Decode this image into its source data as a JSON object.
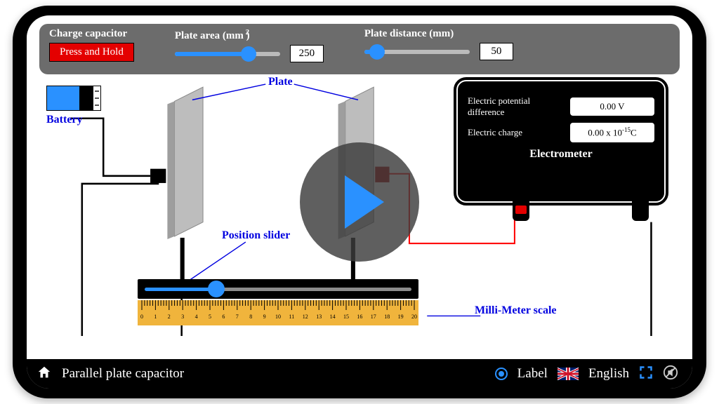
{
  "controls": {
    "charge_label": "Charge capacitor",
    "press_hold": "Press and Hold",
    "area_label": "Plate area (mm   )",
    "area_exponent": "2",
    "area_value": "250",
    "area_slider_pct": 70,
    "distance_label": "Plate distance (mm)",
    "distance_value": "50",
    "distance_slider_pct": 12
  },
  "labels": {
    "plate": "Plate",
    "battery": "Battery",
    "position_slider": "Position slider",
    "mm_scale": "Milli-Meter scale"
  },
  "meter": {
    "potential_label": "Electric potential difference",
    "potential_value": "0.00 V",
    "charge_label": "Electric charge",
    "charge_value_main": "0.00 x 10",
    "charge_exp": "-15",
    "charge_unit": "C",
    "title": "Electrometer"
  },
  "position_slider_pct": 28,
  "ruler": {
    "ticks": [
      "0",
      "1",
      "2",
      "3",
      "4",
      "5",
      "6",
      "7",
      "8",
      "9",
      "10",
      "11",
      "12",
      "13",
      "14",
      "15",
      "16",
      "17",
      "18",
      "19",
      "20"
    ]
  },
  "bottom": {
    "title": "Parallel plate capacitor",
    "label_toggle": "Label",
    "language": "English"
  },
  "colors": {
    "accent": "#2a91ff",
    "red": "#e40000"
  }
}
